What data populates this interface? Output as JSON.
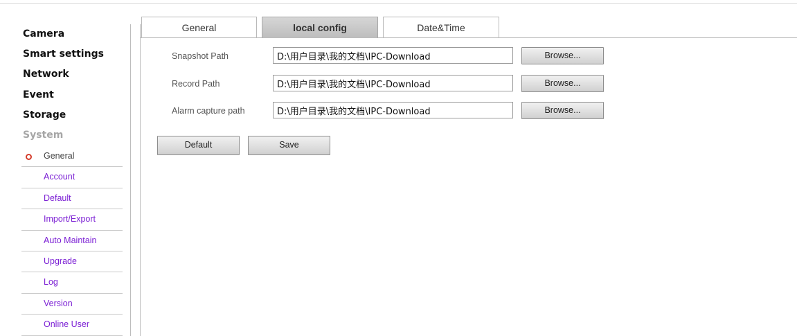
{
  "sidebar": {
    "main_items": [
      {
        "label": "Camera"
      },
      {
        "label": "Smart settings"
      },
      {
        "label": "Network"
      },
      {
        "label": "Event"
      },
      {
        "label": "Storage"
      },
      {
        "label": "System"
      }
    ],
    "system_sub_items": [
      {
        "label": "General",
        "active": true
      },
      {
        "label": "Account"
      },
      {
        "label": "Default"
      },
      {
        "label": "Import/Export"
      },
      {
        "label": "Auto Maintain"
      },
      {
        "label": "Upgrade"
      },
      {
        "label": "Log"
      },
      {
        "label": "Version"
      },
      {
        "label": "Online User"
      }
    ]
  },
  "tabs": [
    {
      "label": "General"
    },
    {
      "label": "local config",
      "active": true
    },
    {
      "label": "Date&Time"
    }
  ],
  "form": {
    "rows": [
      {
        "label": "Snapshot Path",
        "value": "D:\\用户目录\\我的文档\\IPC-Download",
        "button": "Browse..."
      },
      {
        "label": "Record Path",
        "value": "D:\\用户目录\\我的文档\\IPC-Download",
        "button": "Browse..."
      },
      {
        "label": "Alarm capture path",
        "value": "D:\\用户目录\\我的文档\\IPC-Download",
        "button": "Browse..."
      }
    ],
    "default_button": "Default",
    "save_button": "Save"
  },
  "colors": {
    "submenu_link": "#7b1fd4",
    "active_bullet": "#d43d2c",
    "active_tab_bg": "#c8c8c8",
    "system_heading": "#a6a6a6"
  }
}
